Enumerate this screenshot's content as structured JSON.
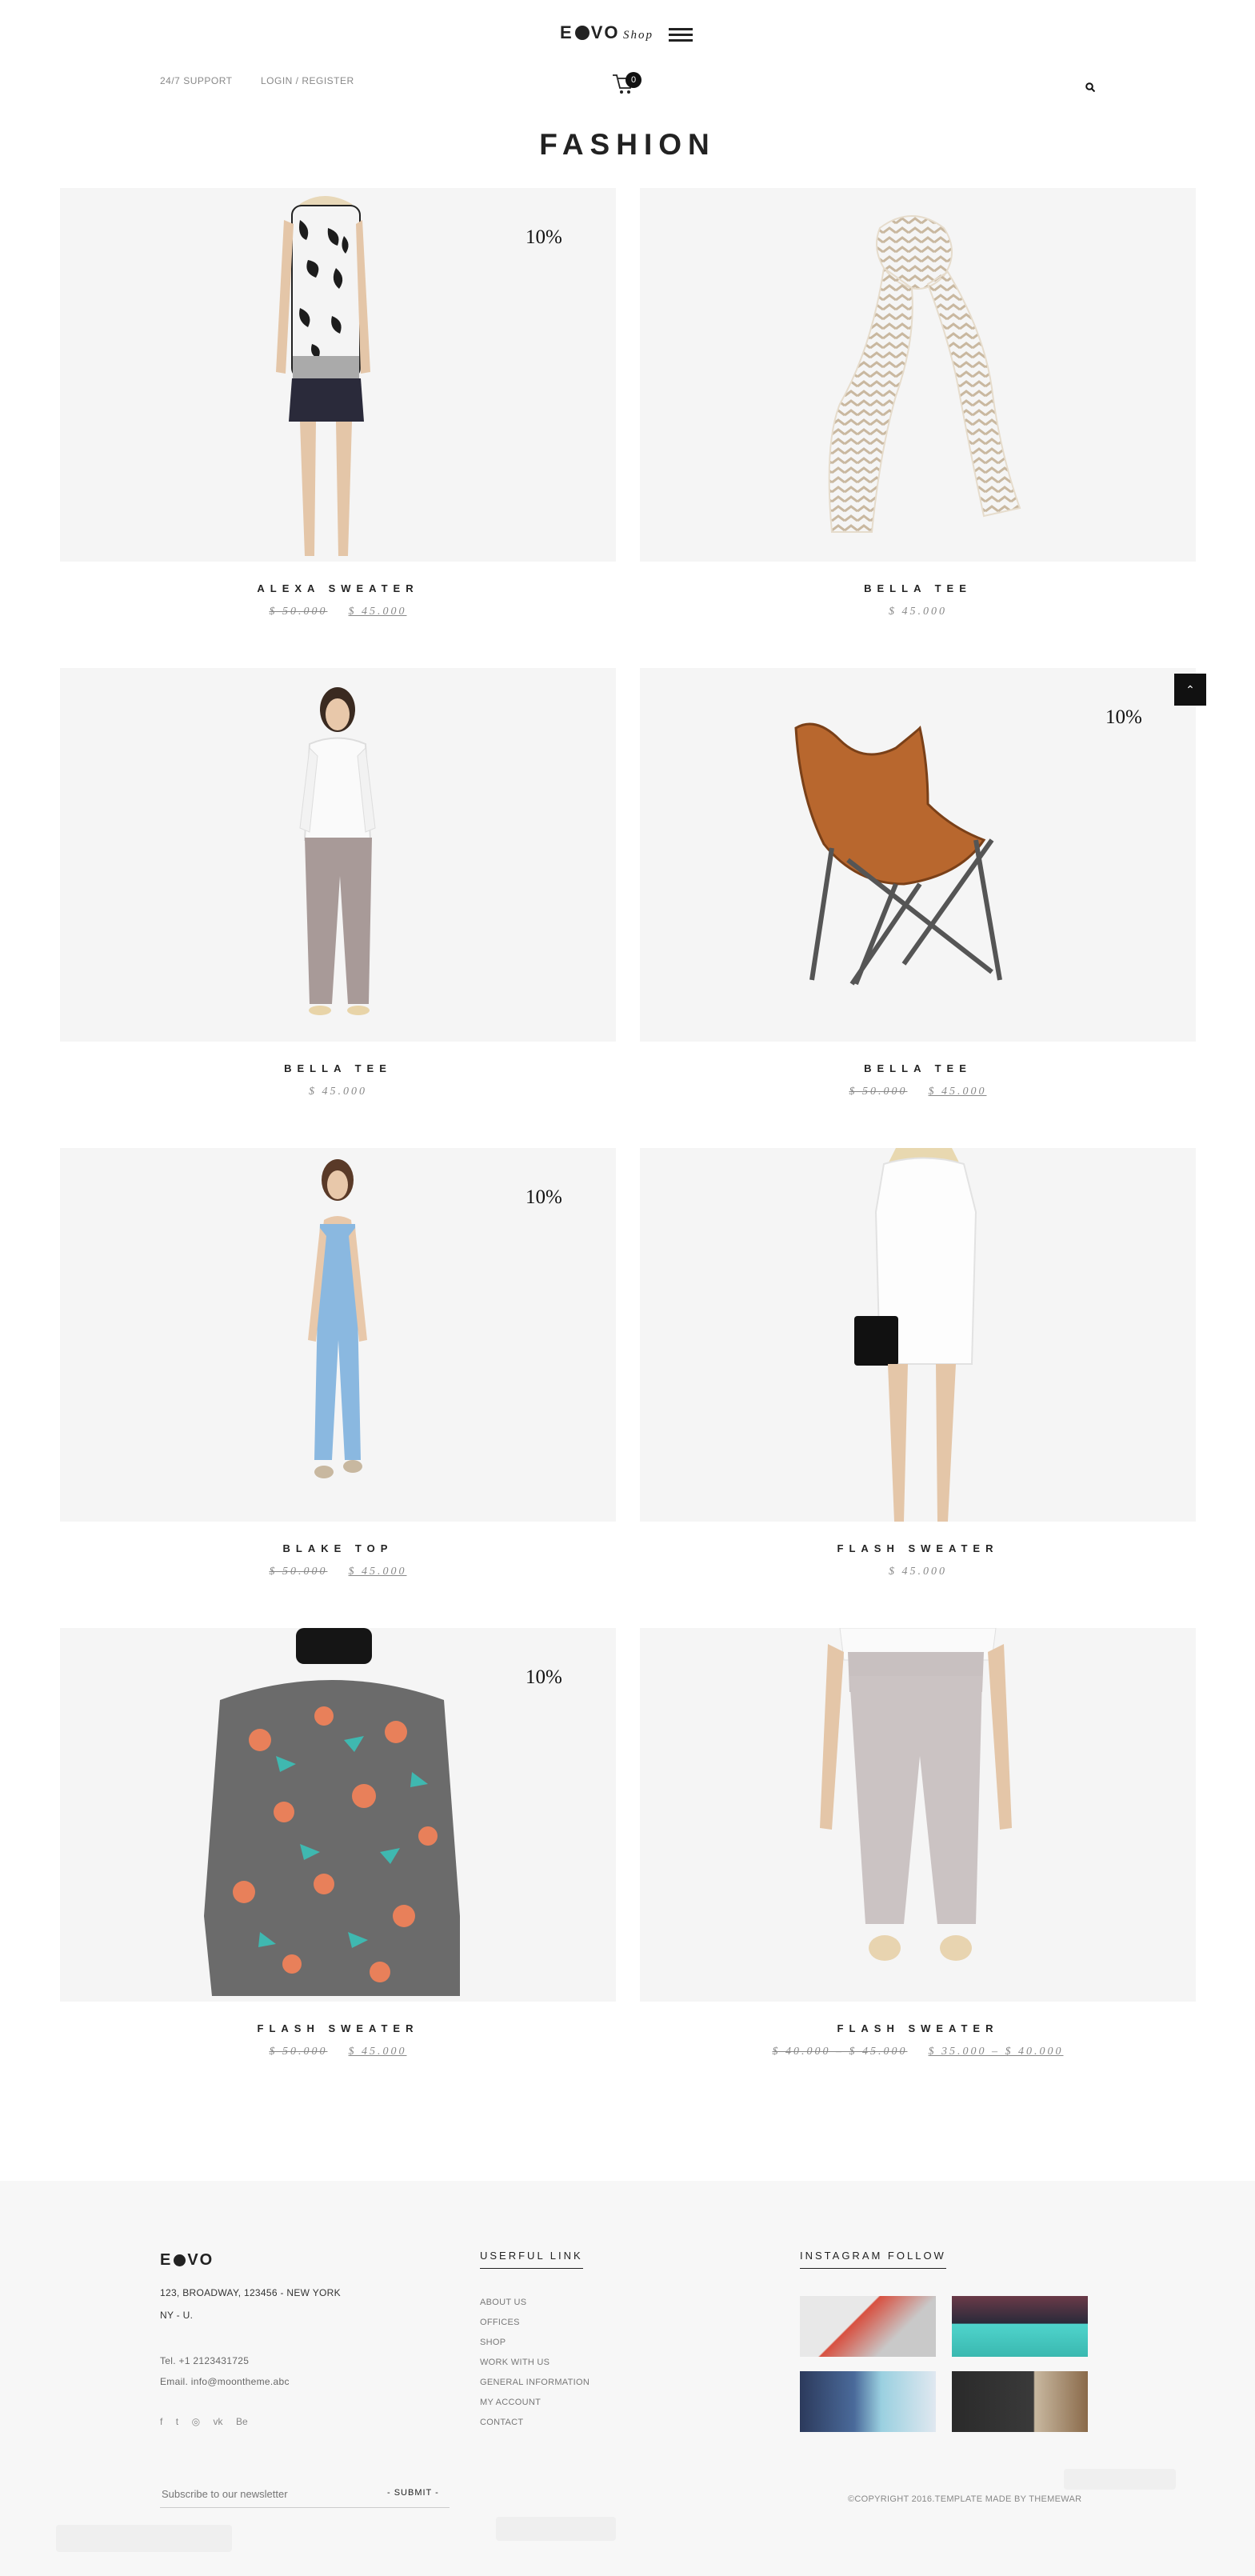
{
  "header": {
    "logo_text": "E●VO",
    "logo_prefix": "E",
    "logo_suffix": "VO",
    "shop_label": "Shop",
    "support_link": "24/7 SUPPORT",
    "login_link": "LOGIN / REGISTER",
    "cart_count": "0"
  },
  "page": {
    "title": "FASHION"
  },
  "products": [
    {
      "name": "ALEXA SWEATER",
      "badge": "10%",
      "old_price": "$ 50.000",
      "new_price": "$ 45.000"
    },
    {
      "name": "BELLA TEE",
      "badge": "",
      "old_price": "",
      "new_price": "$ 45.000"
    },
    {
      "name": "BELLA TEE",
      "badge": "",
      "old_price": "",
      "new_price": "$ 45.000"
    },
    {
      "name": "BELLA TEE",
      "badge": "10%",
      "old_price": "$ 50.000",
      "new_price": "$ 45.000"
    },
    {
      "name": "BLAKE TOP",
      "badge": "10%",
      "old_price": "$ 50.000",
      "new_price": "$ 45.000"
    },
    {
      "name": "FLASH SWEATER",
      "badge": "",
      "old_price": "",
      "new_price": "$ 45.000"
    },
    {
      "name": "FLASH SWEATER",
      "badge": "10%",
      "old_price": "$ 50.000",
      "new_price": "$ 45.000"
    },
    {
      "name": "FLASH SWEATER",
      "badge": "",
      "old_price": "$ 40.000 – $ 45.000",
      "new_price": "$ 35.000 – $ 40.000"
    }
  ],
  "footer": {
    "logo_prefix": "E",
    "logo_suffix": "VO",
    "address_line1": "123, BROADWAY, 123456 - NEW YORK",
    "address_line2": "NY - U.",
    "tel": "Tel. +1 2123431725",
    "email": "Email. info@moontheme.abc",
    "useful_heading": "USERFUL LINK",
    "links": [
      "ABOUT US",
      "OFFICES",
      "SHOP",
      "WORK WITH US",
      "GENERAL INFORMATION",
      "MY ACCOUNT",
      "CONTACT"
    ],
    "instagram_heading": "INSTAGRAM FOLLOW",
    "social": [
      "f",
      "t",
      "◎",
      "vk",
      "Be"
    ],
    "newsletter_placeholder": "Subscribe to our newsletter",
    "submit_label": "- SUBMIT -",
    "copyright": "©COPYRIGHT 2016.TEMPLATE MADE BY THEMEWAR"
  },
  "colors": {
    "card_bg": "#f5f5f5",
    "footer_bg": "#f7f7f7",
    "text": "#222222",
    "muted": "#888888"
  }
}
